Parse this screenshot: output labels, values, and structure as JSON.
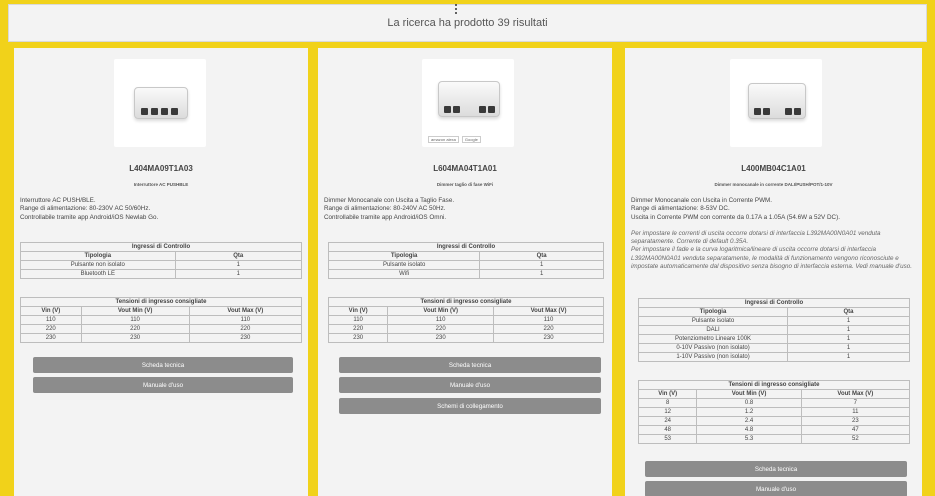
{
  "header": {
    "title": "La ricerca ha prodotto 39 risultati"
  },
  "products": [
    {
      "code": "L404MA09T1A03",
      "subtitle": "Interruttore AC PUSHBLE",
      "description": [
        "Interruttore AC PUSH/BLE.",
        "Range di alimentazione: 80-230V AC 50/60Hz.",
        "Controllabile tramite app Android/iOS Newlab Go."
      ],
      "notes": [],
      "inputs_title": "Ingressi di Controllo",
      "inputs_headers": [
        "Tipologia",
        "Qta"
      ],
      "inputs": [
        [
          "Pulsante non isolato",
          "1"
        ],
        [
          "Bluetooth LE",
          "1"
        ]
      ],
      "voltages_title": "Tensioni di ingresso consigliate",
      "voltages_headers": [
        "Vin (V)",
        "Vout Min (V)",
        "Vout Max (V)"
      ],
      "voltages": [
        [
          "110",
          "110",
          "110"
        ],
        [
          "220",
          "220",
          "220"
        ],
        [
          "230",
          "230",
          "230"
        ]
      ],
      "buttons": [
        "Scheda tecnica",
        "Manuale d'uso"
      ]
    },
    {
      "code": "L604MA04T1A01",
      "subtitle": "Dimmer taglio di fase WiFi",
      "description": [
        "Dimmer Monocanale con Uscita a Taglio Fase.",
        "Range di alimentazione: 80-240V AC 50Hz.",
        "Controllabile tramite app Android/iOS Omni."
      ],
      "notes": [],
      "badges": [
        "amazon alexa",
        "Google"
      ],
      "inputs_title": "Ingressi di Controllo",
      "inputs_headers": [
        "Tipologia",
        "Qta"
      ],
      "inputs": [
        [
          "Pulsante isolato",
          "1"
        ],
        [
          "Wifi",
          "1"
        ]
      ],
      "voltages_title": "Tensioni di ingresso consigliate",
      "voltages_headers": [
        "Vin (V)",
        "Vout Min (V)",
        "Vout Max (V)"
      ],
      "voltages": [
        [
          "110",
          "110",
          "110"
        ],
        [
          "220",
          "220",
          "220"
        ],
        [
          "230",
          "230",
          "230"
        ]
      ],
      "buttons": [
        "Scheda tecnica",
        "Manuale d'uso",
        "Schemi di collegamento"
      ]
    },
    {
      "code": "L400MB04C1A01",
      "subtitle": "Dimmer monocanale in corrente DALI/PUSH/POT/1-10V",
      "description": [
        "Dimmer Monocanale con Uscita in Corrente PWM.",
        "Range di alimentazione: 8-53V DC.",
        "Uscita in Corrente PWM con corrente da 0.17A a 1.05A (54.6W a 52V DC)."
      ],
      "notes": [
        "Per impostare le correnti di uscita occorre dotarsi di interfaccia L392MA00N0A01 venduta separatamente. Corrente di default 0.35A.",
        "Per impostare il fade e la curva logaritmica/lineare di uscita occorre dotarsi di interfaccia L392MA00N0A01 venduta separatamente, le modalità di funzionamento vengono riconosciute e impostate automaticamente dal dispositivo senza bisogno di interfaccia esterna. Vedi manuale d'uso."
      ],
      "inputs_title": "Ingressi di Controllo",
      "inputs_headers": [
        "Tipologia",
        "Qta"
      ],
      "inputs": [
        [
          "Pulsante isolato",
          "1"
        ],
        [
          "DALI",
          "1"
        ],
        [
          "Potenziometro Lineare 100K",
          "1"
        ],
        [
          "0-10V Passivo (non isolato)",
          "1"
        ],
        [
          "1-10V Passivo (non isolato)",
          "1"
        ]
      ],
      "voltages_title": "Tensioni di ingresso consigliate",
      "voltages_headers": [
        "Vin (V)",
        "Vout Min (V)",
        "Vout Max (V)"
      ],
      "voltages": [
        [
          "8",
          "0.8",
          "7"
        ],
        [
          "12",
          "1.2",
          "11"
        ],
        [
          "24",
          "2.4",
          "23"
        ],
        [
          "48",
          "4.8",
          "47"
        ],
        [
          "53",
          "5.3",
          "52"
        ]
      ],
      "buttons": [
        "Scheda tecnica",
        "Manuale d'uso"
      ]
    }
  ]
}
